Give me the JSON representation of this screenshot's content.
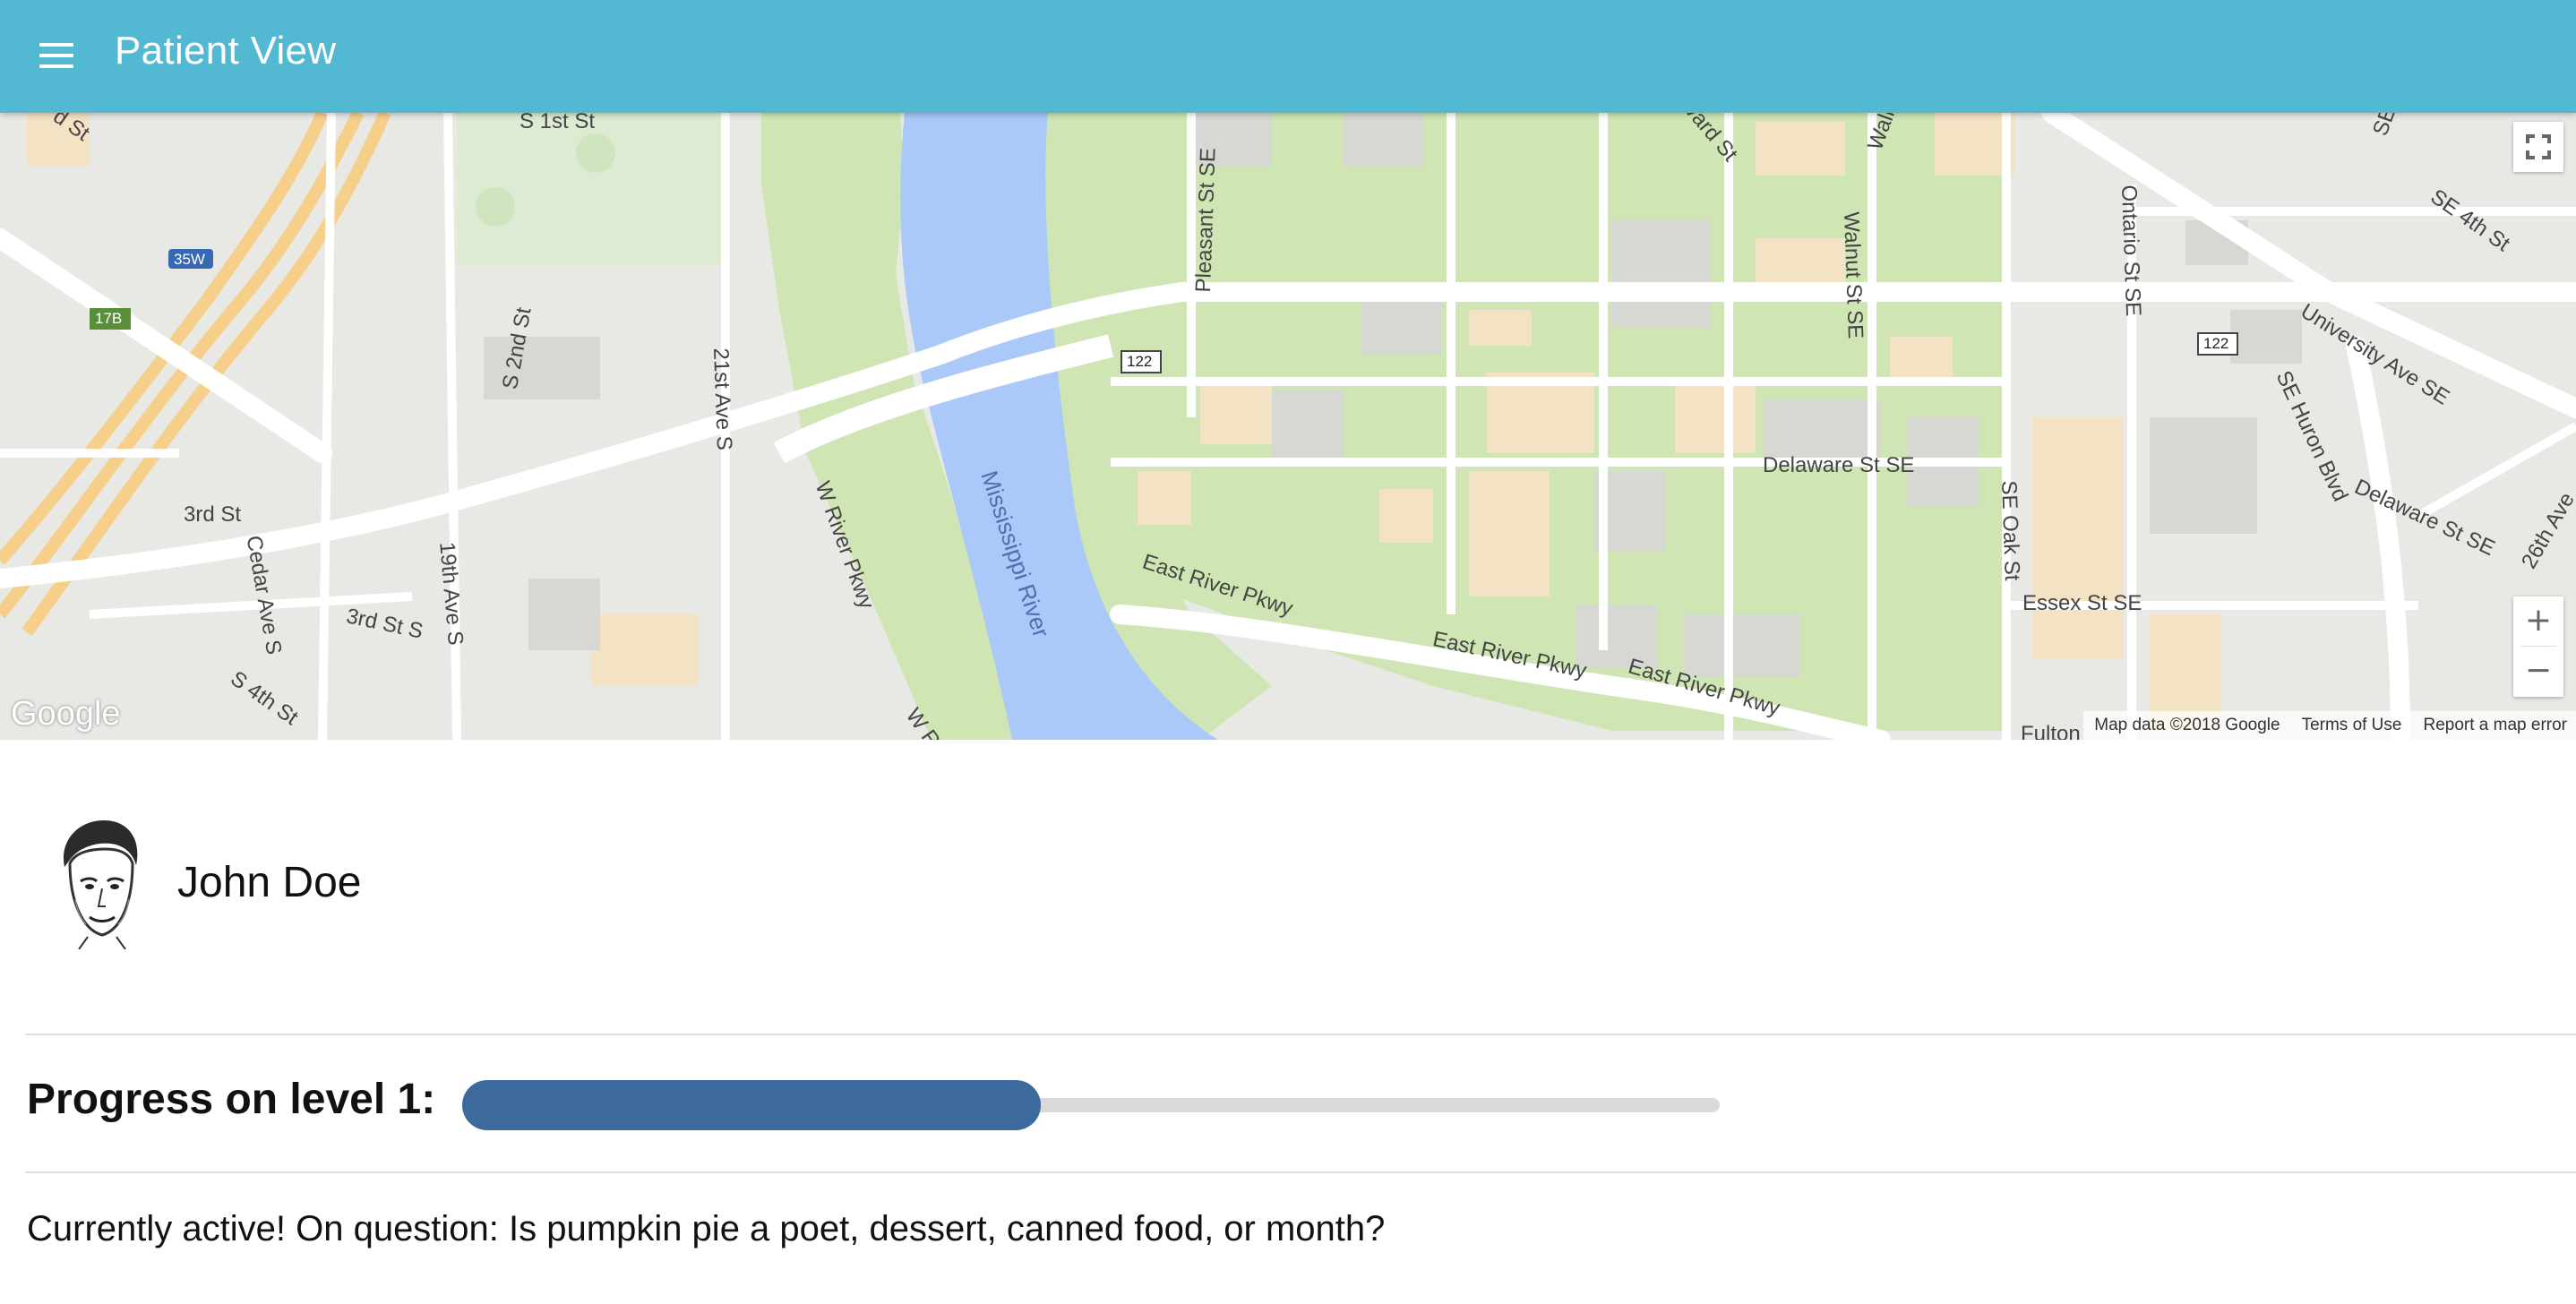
{
  "app": {
    "title": "Patient View",
    "menu_icon": "menu-icon",
    "accent_color": "#53b9d3"
  },
  "map": {
    "labels": {
      "cedar_ave_s": "Cedar Ave S",
      "nineteenth_ave_s": "19th Ave S",
      "twenty_first_ave_s": "21st Ave S",
      "s_second_st": "S 2nd St",
      "s_first_st": "S 1st St",
      "third_st": "3rd St",
      "third_st_s": "3rd St S",
      "s_fourth_st": "S 4th St",
      "w_river_pkwy": "W River Pkwy",
      "w_river_pkwy_2": "W R",
      "mississippi_river": "Mississippi River",
      "east_river_pkwy": "East River Pkwy",
      "pleasant_st_se": "Pleasant St SE",
      "walnut_st_se": "Walnut St SE",
      "walnut_st": "Walnut St",
      "harvard_st": "vard St",
      "ontario_st_se": "Ontario St SE",
      "delaware_st_se": "Delaware St SE",
      "se_oak_st": "SE Oak St",
      "essex_st_se": "Essex St SE",
      "se_huron_blvd": "SE Huron Blvd",
      "university_ave_se": "University Ave SE",
      "se_4th_st": "SE 4th St",
      "twenty_sixth_ave": "26th Ave",
      "fulton": "Fulton",
      "d_st": "d St",
      "se": "SE",
      "shield_35w": "35W",
      "shield_17b": "17B",
      "shield_122": "122"
    },
    "google_logo": "Google",
    "attribution": {
      "map_data": "Map data ©2018 Google",
      "terms": "Terms of Use",
      "report": "Report a map error"
    },
    "zoom_in_label": "+",
    "zoom_out_label": "−"
  },
  "patient": {
    "name": "John Doe",
    "avatar_icon": "patient-avatar"
  },
  "progress": {
    "label": "Progress on level 1:",
    "fraction": 0.46,
    "color": "#3d6a9c"
  },
  "status": {
    "text": "Currently active! On question: Is pumpkin pie a poet, dessert, canned food, or month?"
  }
}
